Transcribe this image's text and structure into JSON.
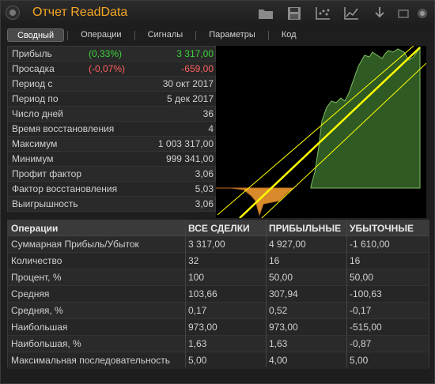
{
  "window": {
    "title": "Отчет ReadData"
  },
  "toolbar": {
    "icons": [
      "folder-icon",
      "save-icon",
      "scatter-chart-icon",
      "line-chart-icon",
      "download-icon",
      "minimize-icon",
      "close-icon"
    ]
  },
  "tabs": [
    {
      "label": "Сводный",
      "active": true
    },
    {
      "label": "Операции",
      "active": false
    },
    {
      "label": "Сигналы",
      "active": false
    },
    {
      "label": "Параметры",
      "active": false
    },
    {
      "label": "Код",
      "active": false
    }
  ],
  "stats": [
    {
      "label": "Прибыль",
      "pct": "(0,33%)",
      "pct_color": "#3cd23c",
      "value": "3 317,00",
      "value_color": "#3cd23c"
    },
    {
      "label": "Просадка",
      "pct": "(-0,07%)",
      "pct_color": "#ff6060",
      "value": "-659,00",
      "value_color": "#ff6060"
    },
    {
      "label": "Период с",
      "pct": "",
      "value": "30 окт 2017"
    },
    {
      "label": "Период по",
      "pct": "",
      "value": "5 дек 2017"
    },
    {
      "label": "Число дней",
      "pct": "",
      "value": "36"
    },
    {
      "label": "Время восстановления",
      "pct": "",
      "value": "4"
    },
    {
      "label": "Максимум",
      "pct": "",
      "value": "1 003 317,00"
    },
    {
      "label": "Минимум",
      "pct": "",
      "value": "999 341,00"
    },
    {
      "label": "Профит фактор",
      "pct": "",
      "value": "3,06"
    },
    {
      "label": "Фактор восстановления",
      "pct": "",
      "value": "5,03"
    },
    {
      "label": "Выигрышность",
      "pct": "",
      "value": "3,06"
    }
  ],
  "chart_data": {
    "type": "area",
    "colors": {
      "equity": "#7fbf5f",
      "equity_fill": "#2f5a24",
      "drawdown": "#d98a2a",
      "trend": "#ffff00"
    }
  },
  "ops_table": {
    "headers": [
      "Операции",
      "ВСЕ СДЕЛКИ",
      "ПРИБЫЛЬНЫЕ",
      "УБЫТОЧНЫЕ"
    ],
    "rows": [
      [
        "Суммарная Прибыль/Убыток",
        "3 317,00",
        "4 927,00",
        "-1 610,00"
      ],
      [
        "Количество",
        "32",
        "16",
        "16"
      ],
      [
        "Процент, %",
        "100",
        "50,00",
        "50,00"
      ],
      [
        "Средняя",
        "103,66",
        "307,94",
        "-100,63"
      ],
      [
        "Средняя, %",
        "0,17",
        "0,52",
        "-0,17"
      ],
      [
        "Наибольшая",
        "973,00",
        "973,00",
        "-515,00"
      ],
      [
        "Наибольшая, %",
        "1,63",
        "1,63",
        "-0,87"
      ],
      [
        "Максимальная последовательность",
        "5,00",
        "4,00",
        "5,00"
      ]
    ]
  }
}
